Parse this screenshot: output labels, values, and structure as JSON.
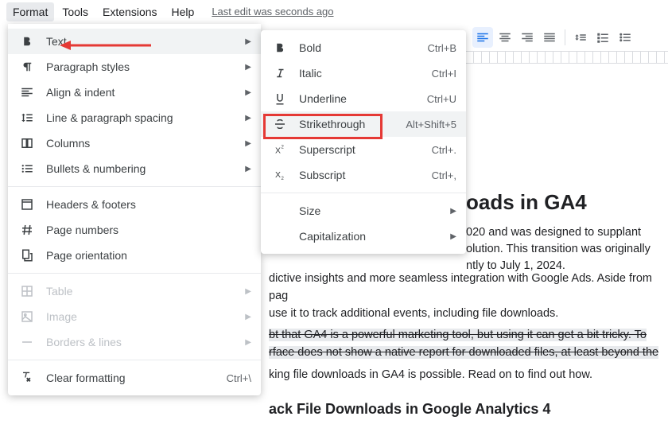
{
  "menubar": {
    "items": [
      "Format",
      "Tools",
      "Extensions",
      "Help"
    ],
    "last_edit": "Last edit was seconds ago"
  },
  "format_menu": {
    "groups": [
      [
        {
          "icon": "bold",
          "label": "Text",
          "caret": true,
          "hover": true
        },
        {
          "icon": "pstyles",
          "label": "Paragraph styles",
          "caret": true
        },
        {
          "icon": "align",
          "label": "Align & indent",
          "caret": true
        },
        {
          "icon": "spacing",
          "label": "Line & paragraph spacing",
          "caret": true
        },
        {
          "icon": "columns",
          "label": "Columns",
          "caret": true
        },
        {
          "icon": "bullets",
          "label": "Bullets & numbering",
          "caret": true
        }
      ],
      [
        {
          "icon": "headers",
          "label": "Headers & footers"
        },
        {
          "icon": "hash",
          "label": "Page numbers"
        },
        {
          "icon": "orient",
          "label": "Page orientation"
        }
      ],
      [
        {
          "icon": "table",
          "label": "Table",
          "caret": true,
          "disabled": true
        },
        {
          "icon": "image",
          "label": "Image",
          "caret": true,
          "disabled": true
        },
        {
          "icon": "borders",
          "label": "Borders & lines",
          "caret": true,
          "disabled": true
        }
      ],
      [
        {
          "icon": "clear",
          "label": "Clear formatting",
          "shortcut": "Ctrl+\\"
        }
      ]
    ]
  },
  "text_submenu": {
    "items": [
      {
        "icon": "bold",
        "label": "Bold",
        "shortcut": "Ctrl+B"
      },
      {
        "icon": "italic",
        "label": "Italic",
        "shortcut": "Ctrl+I"
      },
      {
        "icon": "underline",
        "label": "Underline",
        "shortcut": "Ctrl+U"
      },
      {
        "icon": "strike",
        "label": "Strikethrough",
        "shortcut": "Alt+Shift+5",
        "hover": true
      },
      {
        "icon": "super",
        "label": "Superscript",
        "shortcut": "Ctrl+."
      },
      {
        "icon": "sub",
        "label": "Subscript",
        "shortcut": "Ctrl+,"
      }
    ],
    "more": [
      {
        "label": "Size",
        "caret": true
      },
      {
        "label": "Capitalization",
        "caret": true
      }
    ]
  },
  "document": {
    "h1_fragment": "oads in GA4",
    "p1a": "020 and was designed to supplant",
    "p1b": "olution. This transition was originally",
    "p1c": "ntly to July 1, 2024.",
    "p2": "dictive insights and more seamless integration with Google Ads. Aside from pag",
    "p3": "use it to track additional events, including file downloads.",
    "s1": "bt that GA4 is a powerful marketing tool, but using it can get a bit tricky. To",
    "s2": "rface does not show a native report for downloaded files, at least beyond the",
    "s3": "",
    "p4": "king file downloads in GA4 is possible. Read on to find out how.",
    "h2": "ack File Downloads in Google Analytics 4"
  }
}
